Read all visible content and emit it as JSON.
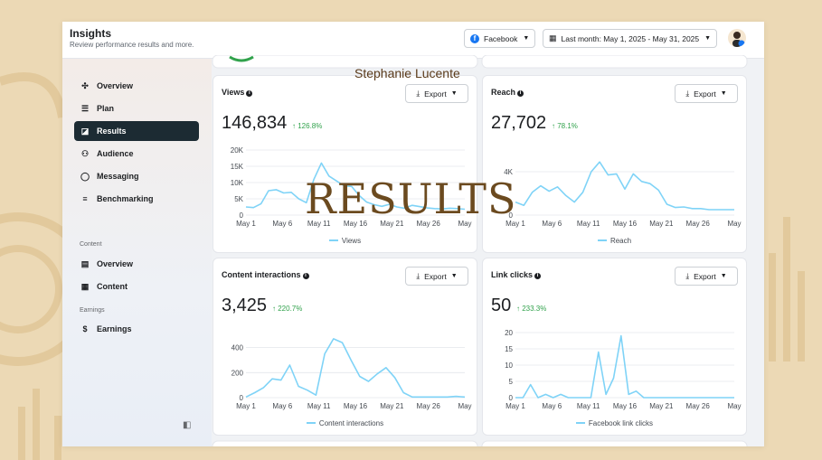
{
  "overlay": {
    "author": "Stephanie Lucente",
    "title": "RESULTS"
  },
  "header": {
    "title": "Insights",
    "subtitle": "Review performance results and more.",
    "platform_label": "Facebook",
    "date_range_label": "Last month: May 1, 2025 - May 31, 2025"
  },
  "sidebar": {
    "items": [
      {
        "label": "Overview",
        "icon": "scatter-icon",
        "active": false
      },
      {
        "label": "Plan",
        "icon": "list-icon",
        "active": false
      },
      {
        "label": "Results",
        "icon": "trend-icon",
        "active": true
      },
      {
        "label": "Audience",
        "icon": "people-icon",
        "active": false
      },
      {
        "label": "Messaging",
        "icon": "chat-icon",
        "active": false
      },
      {
        "label": "Benchmarking",
        "icon": "benchmark-icon",
        "active": false
      }
    ],
    "content_section": "Content",
    "content_items": [
      {
        "label": "Overview",
        "icon": "grid-icon"
      },
      {
        "label": "Content",
        "icon": "content-icon"
      }
    ],
    "earnings_section": "Earnings",
    "earnings_items": [
      {
        "label": "Earnings",
        "icon": "dollar-icon"
      }
    ]
  },
  "export_label": "Export",
  "colors": {
    "accent": "#1c2b33",
    "line": "#7fd3f7",
    "positive": "#31a24c",
    "facebook": "#1877f2"
  },
  "cards": [
    {
      "title": "Views",
      "total": "146,834",
      "delta": "↑ 126.8%",
      "legend": "Views",
      "chart_data": {
        "type": "line",
        "x_ticks": [
          "May 1",
          "May 6",
          "May 11",
          "May 16",
          "May 21",
          "May 26",
          "May"
        ],
        "y_ticks": [
          "20K",
          "15K",
          "10K",
          "5K",
          "0"
        ],
        "ylim": [
          0,
          20000
        ],
        "values": [
          2500,
          2300,
          3500,
          7500,
          7800,
          6800,
          7000,
          5000,
          3800,
          11000,
          16000,
          12000,
          10500,
          9000,
          8800,
          6000,
          4000,
          3200,
          2700,
          3300,
          2500,
          2100,
          3000,
          2600,
          2200,
          2000,
          1900,
          2100,
          2000,
          1800
        ]
      }
    },
    {
      "title": "Reach",
      "total": "27,702",
      "delta": "↑ 78.1%",
      "legend": "Reach",
      "chart_data": {
        "type": "line",
        "x_ticks": [
          "May 1",
          "May 6",
          "May 11",
          "May 16",
          "May 21",
          "May 26",
          "May"
        ],
        "y_ticks": [
          "4K",
          "0"
        ],
        "ylim": [
          0,
          6000
        ],
        "values": [
          1200,
          900,
          2100,
          2700,
          2200,
          2600,
          1800,
          1200,
          2100,
          4000,
          4900,
          3700,
          3800,
          2400,
          3800,
          3100,
          2900,
          2300,
          1000,
          700,
          750,
          600,
          600,
          500,
          500,
          500,
          500
        ]
      }
    },
    {
      "title": "Content interactions",
      "total": "3,425",
      "delta": "↑ 220.7%",
      "legend": "Content interactions",
      "chart_data": {
        "type": "line",
        "x_ticks": [
          "May 1",
          "May 6",
          "May 11",
          "May 16",
          "May 21",
          "May 26",
          "May"
        ],
        "y_ticks": [
          "400",
          "200",
          "0"
        ],
        "ylim": [
          0,
          520
        ],
        "values": [
          5,
          40,
          80,
          150,
          140,
          260,
          90,
          60,
          20,
          350,
          470,
          440,
          300,
          170,
          130,
          190,
          240,
          160,
          40,
          5,
          5,
          5,
          5,
          5,
          10,
          5
        ]
      }
    },
    {
      "title": "Link clicks",
      "total": "50",
      "delta": "↑ 233.3%",
      "legend": "Facebook link clicks",
      "chart_data": {
        "type": "line",
        "x_ticks": [
          "May 1",
          "May 6",
          "May 11",
          "May 16",
          "May 21",
          "May 26",
          "May"
        ],
        "y_ticks": [
          "20",
          "15",
          "10",
          "5",
          "0"
        ],
        "ylim": [
          0,
          20
        ],
        "values": [
          0,
          0,
          4,
          0,
          1,
          0,
          1,
          0,
          0,
          0,
          0,
          14,
          1,
          6,
          19,
          1,
          2,
          0,
          0,
          0,
          0,
          0,
          0,
          0,
          0,
          0,
          0,
          0,
          0,
          0
        ]
      }
    }
  ]
}
